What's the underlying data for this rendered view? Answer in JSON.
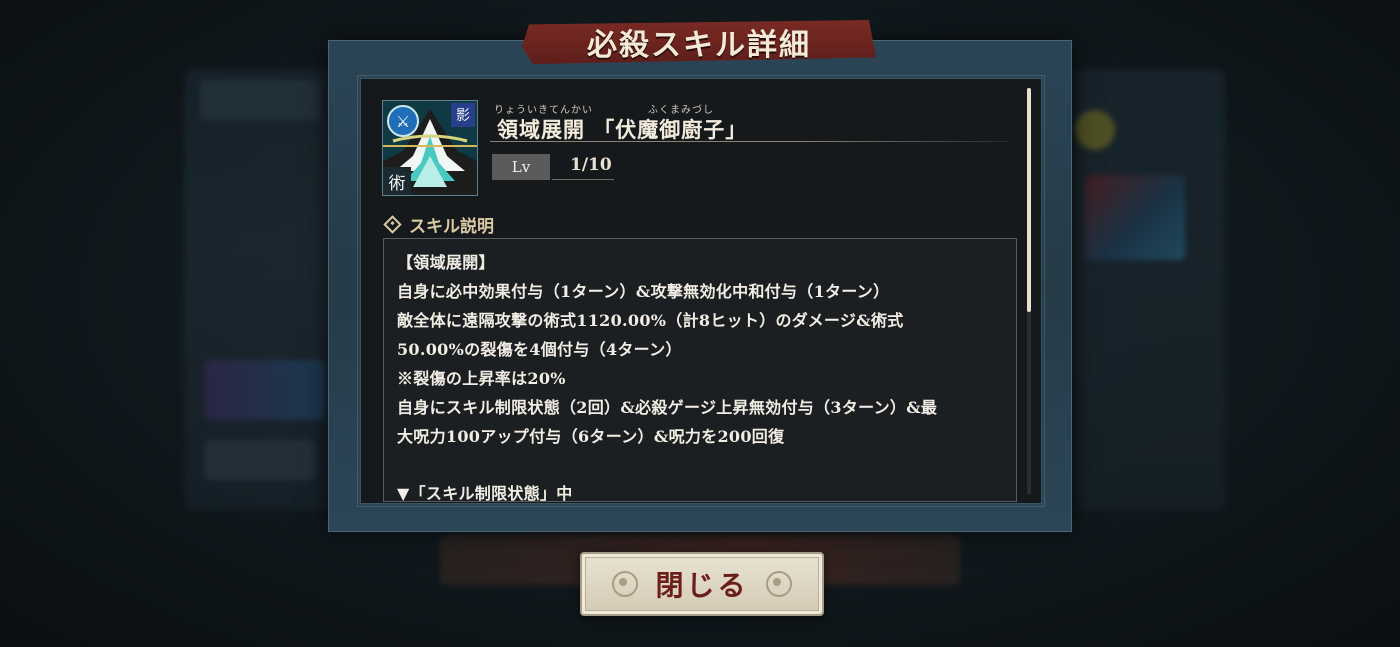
{
  "dialog": {
    "title": "必殺スキル詳細"
  },
  "skill": {
    "icon_badges": {
      "top_right": "影",
      "bottom_left": "術"
    },
    "name_ruby_left": "りょういきてんかい",
    "name_ruby_right": "ふくまみづし",
    "name": "領域展開 「伏魔御廚子」",
    "level_label": "Lv",
    "level_value": "1/10"
  },
  "description": {
    "section_label": "スキル説明",
    "lines": [
      "【領域展開】",
      "自身に必中効果付与（1ターン）&攻撃無効化中和付与（1ターン）",
      "敵全体に遠隔攻撃の術式1120.00%（計8ヒット）のダメージ&術式",
      "50.00%の裂傷を4個付与（4ターン）",
      "※裂傷の上昇率は20%",
      "自身にスキル制限状態（2回）&必殺ゲージ上昇無効付与（3ターン）&最",
      "大呪力100アップ付与（6ターン）&呪力を200回復",
      "",
      "▼「スキル制限状態」中"
    ]
  },
  "close_button": {
    "label": "閉じる"
  },
  "colors": {
    "banner": "#6e241f",
    "frame": "#2b4556",
    "panel": "#16191b",
    "accent_text": "#d9c9a4",
    "button_text": "#6b1f1a"
  }
}
